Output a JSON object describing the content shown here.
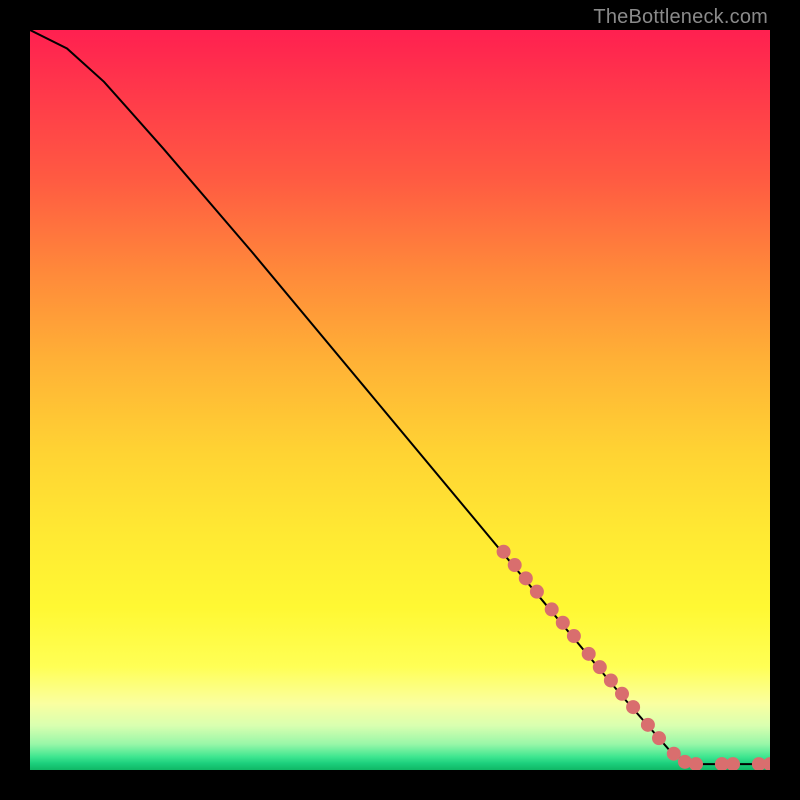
{
  "credit": "TheBottleneck.com",
  "chart_data": {
    "type": "line",
    "title": "",
    "xlabel": "",
    "ylabel": "",
    "xlim": [
      0,
      100
    ],
    "ylim": [
      0,
      100
    ],
    "grid": false,
    "series": [
      {
        "name": "curve",
        "style": "solid",
        "color": "#000000",
        "points": [
          {
            "x": 0,
            "y": 100
          },
          {
            "x": 5,
            "y": 97.5
          },
          {
            "x": 10,
            "y": 93
          },
          {
            "x": 18,
            "y": 84
          },
          {
            "x": 30,
            "y": 70
          },
          {
            "x": 45,
            "y": 52
          },
          {
            "x": 60,
            "y": 34
          },
          {
            "x": 70,
            "y": 22
          },
          {
            "x": 80,
            "y": 10
          },
          {
            "x": 87,
            "y": 2
          },
          {
            "x": 90,
            "y": 0.8
          },
          {
            "x": 93,
            "y": 0.8
          },
          {
            "x": 96,
            "y": 0.8
          },
          {
            "x": 100,
            "y": 0.8
          }
        ]
      }
    ],
    "markers": [
      {
        "x": 64,
        "y": 29.5
      },
      {
        "x": 65.5,
        "y": 27.7
      },
      {
        "x": 67,
        "y": 25.9
      },
      {
        "x": 68.5,
        "y": 24.1
      },
      {
        "x": 70.5,
        "y": 21.7
      },
      {
        "x": 72,
        "y": 19.9
      },
      {
        "x": 73.5,
        "y": 18.1
      },
      {
        "x": 75.5,
        "y": 15.7
      },
      {
        "x": 77,
        "y": 13.9
      },
      {
        "x": 78.5,
        "y": 12.1
      },
      {
        "x": 80,
        "y": 10.3
      },
      {
        "x": 81.5,
        "y": 8.5
      },
      {
        "x": 83.5,
        "y": 6.1
      },
      {
        "x": 85,
        "y": 4.3
      },
      {
        "x": 87,
        "y": 2.2
      },
      {
        "x": 88.5,
        "y": 1.1
      },
      {
        "x": 90,
        "y": 0.8
      },
      {
        "x": 93.5,
        "y": 0.8
      },
      {
        "x": 95,
        "y": 0.8
      },
      {
        "x": 98.5,
        "y": 0.8
      },
      {
        "x": 100,
        "y": 0.8
      }
    ],
    "marker_color": "#d96e6e",
    "marker_radius": 7
  }
}
